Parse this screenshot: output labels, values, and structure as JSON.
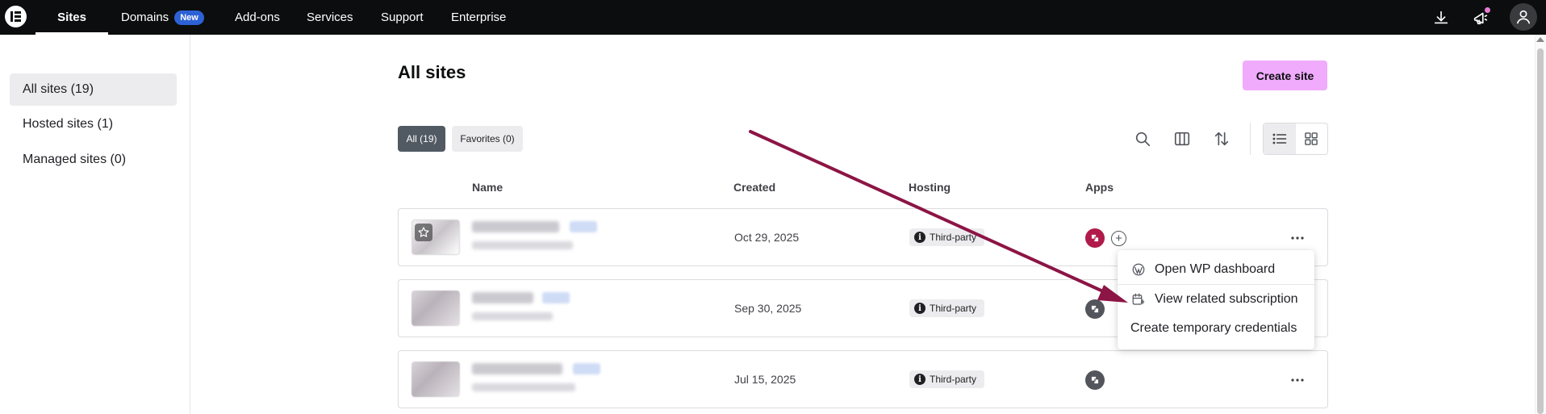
{
  "nav": {
    "items": [
      {
        "label": "Sites",
        "active": true
      },
      {
        "label": "Domains",
        "badge": "New"
      },
      {
        "label": "Add-ons"
      },
      {
        "label": "Services"
      },
      {
        "label": "Support"
      },
      {
        "label": "Enterprise"
      }
    ],
    "right_icons": [
      "download-icon",
      "megaphone-icon",
      "user-avatar-icon"
    ]
  },
  "sidebar": {
    "items": [
      {
        "label": "All sites (19)",
        "active": true
      },
      {
        "label": "Hosted sites (1)"
      },
      {
        "label": "Managed sites (0)"
      }
    ]
  },
  "main": {
    "title": "All sites",
    "create_button": "Create site",
    "filters": [
      {
        "label": "All (19)",
        "active": true
      },
      {
        "label": "Favorites (0)"
      }
    ],
    "toolbar_icons": [
      "search-icon",
      "columns-icon",
      "sort-icon",
      "list-view-icon",
      "grid-view-icon"
    ],
    "columns": {
      "name": "Name",
      "created": "Created",
      "hosting": "Hosting",
      "apps": "Apps"
    },
    "rows": [
      {
        "created": "Oct 29, 2025",
        "hosting": "Third-party",
        "app": "brand"
      },
      {
        "created": "Sep 30, 2025",
        "hosting": "Third-party",
        "app": "grey"
      },
      {
        "created": "Jul 15, 2025",
        "hosting": "Third-party",
        "app": "grey"
      }
    ]
  },
  "context_menu": {
    "items": [
      {
        "label": "Open WP dashboard",
        "icon": "wordpress-icon"
      },
      {
        "label": "View related subscription",
        "icon": "calendar-subscription-icon"
      },
      {
        "label": "Create temporary credentials"
      }
    ]
  },
  "colors": {
    "topbar": "#0c0d0e",
    "accent_pink": "#f0abfc",
    "badge_blue": "#2d62d6",
    "annotation_arrow": "#8c1545"
  }
}
